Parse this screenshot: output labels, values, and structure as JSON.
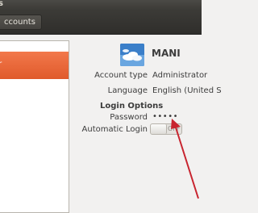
{
  "window": {
    "title": "s"
  },
  "toolbar": {
    "breadcrumb": "ccounts"
  },
  "user_list": {
    "selected_user_text": "or"
  },
  "user": {
    "name": "MANI",
    "avatar_icon": "sky-clouds-avatar"
  },
  "details": {
    "account_type_label": "Account type",
    "account_type_value": "Administrator",
    "language_label": "Language",
    "language_value": "English (United S"
  },
  "login_options": {
    "heading": "Login Options",
    "password_label": "Password",
    "password_value": "•••••",
    "auto_login_label": "Automatic Login",
    "auto_login_state": "OFF"
  },
  "colors": {
    "selection": "#e9622f",
    "annotation_arrow": "#c8242f"
  }
}
